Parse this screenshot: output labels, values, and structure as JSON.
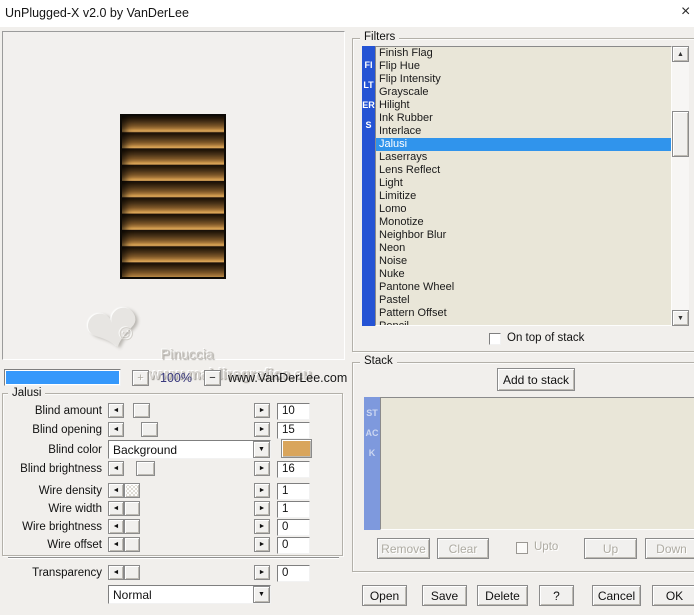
{
  "window": {
    "title": "UnPlugged-X v2.0 by VanDerLee"
  },
  "icons": {
    "close": "×",
    "scroll_up": "▲",
    "scroll_down": "▼",
    "arrow_left": "◄",
    "arrow_right": "►",
    "dropdown": "▼",
    "plus": "+",
    "minus": "−",
    "heart": "❤",
    "smile": "☺"
  },
  "preview": {
    "watermark_name": "Pinuccia",
    "watermark_site": "www.maidiregrafica.eu"
  },
  "zoom_bar": {
    "progress_percent": 100,
    "zoom_level": "100%",
    "website": "www.VanDerLee.com"
  },
  "filters_panel": {
    "group_label": "Filters",
    "vertical_label": "FILTERS",
    "selected": "Jalusi",
    "items": [
      "Finish Flag",
      "Flip Hue",
      "Flip Intensity",
      "Grayscale",
      "Hilight",
      "Ink Rubber",
      "Interlace",
      "Jalusi",
      "Laserrays",
      "Lens Reflect",
      "Light",
      "Limitize",
      "Lomo",
      "Monotize",
      "Neighbor Blur",
      "Neon",
      "Noise",
      "Nuke",
      "Pantone Wheel",
      "Pastel",
      "Pattern Offset",
      "Pencil"
    ],
    "on_top_label": "On top of stack",
    "on_top_checked": false
  },
  "stack_panel": {
    "group_label": "Stack",
    "vertical_label": "STACK",
    "add_button": "Add to stack",
    "remove_button": "Remove",
    "clear_button": "Clear",
    "upto_label": "Upto",
    "upto_checked": false,
    "up_button": "Up",
    "down_button": "Down"
  },
  "parameters": {
    "group_label": "Jalusi",
    "rows": [
      {
        "label": "Blind amount",
        "value": "10"
      },
      {
        "label": "Blind opening",
        "value": "15"
      },
      {
        "label": "Blind color",
        "value": "Background",
        "swatch_color": "#d9a55c"
      },
      {
        "label": "Blind brightness",
        "value": "16"
      },
      {
        "label": "Wire density",
        "value": "1"
      },
      {
        "label": "Wire width",
        "value": "1"
      },
      {
        "label": "Wire brightness",
        "value": "0"
      },
      {
        "label": "Wire offset",
        "value": "0"
      }
    ],
    "transparency": {
      "label": "Transparency",
      "value": "0"
    },
    "blend_mode": "Normal"
  },
  "dialog_buttons": {
    "open": "Open",
    "save": "Save",
    "delete": "Delete",
    "help": "?",
    "cancel": "Cancel",
    "ok": "OK"
  },
  "colors": {
    "filters_strip": "#2453d4",
    "stack_strip": "#7e99dd",
    "selection": "#3094ec",
    "progress_bar": "#3598fb",
    "list_background": "#e9e6d8",
    "blind_swatch": "#d9a55c"
  }
}
